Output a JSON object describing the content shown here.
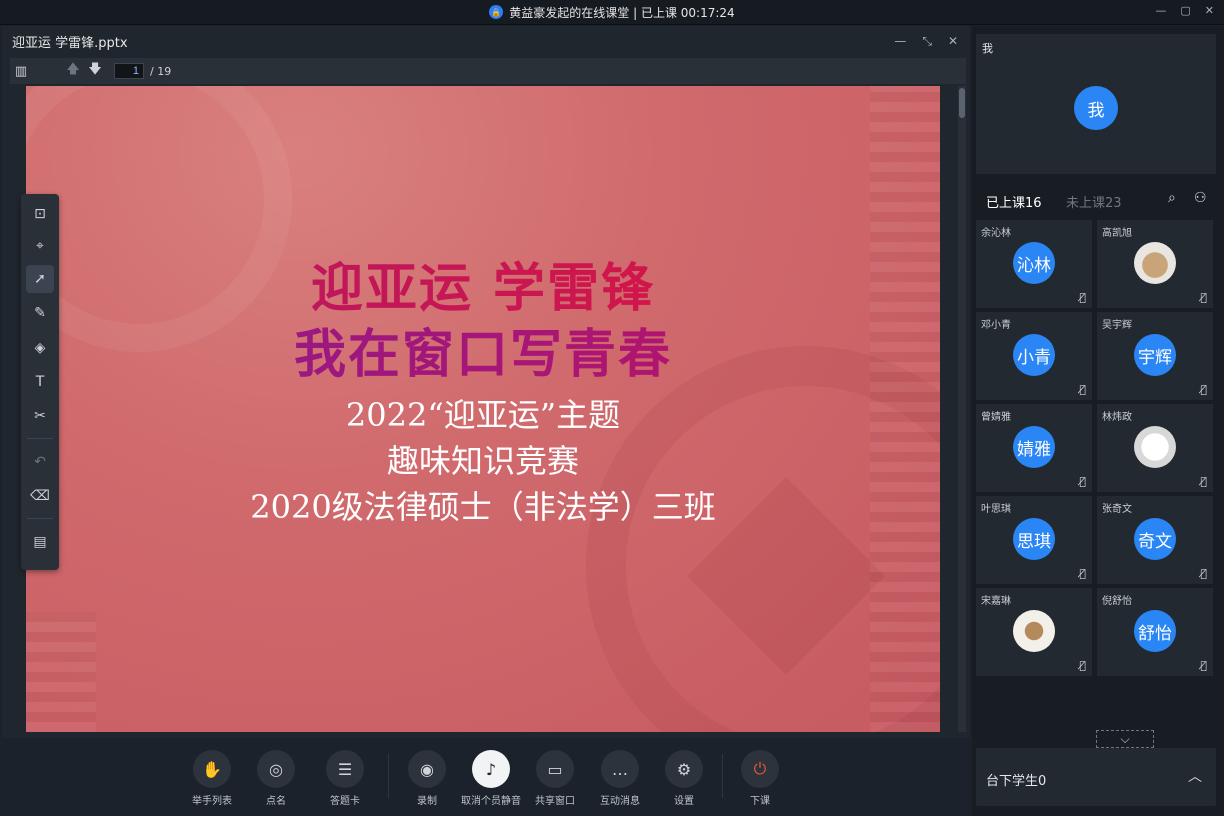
{
  "window": {
    "title": "黄益豪发起的在线课堂 | 已上课 00:17:24",
    "controls": [
      "—",
      "▢",
      "✕"
    ]
  },
  "document": {
    "filename": "迎亚运 学雷锋.pptx",
    "header_controls": [
      "—",
      "⤡",
      "✕"
    ],
    "page_current": "1",
    "page_total": "/ 19",
    "slide": {
      "line1": "迎亚运  学雷锋",
      "line2": "我在窗口写青春",
      "line3": "2022“迎亚运”主题",
      "line4": "趣味知识竞赛",
      "line5": "2020级法律硕士（非法学）三班"
    }
  },
  "toolbar_icons": [
    "sidebar-toggle-icon",
    "arrow-up-icon",
    "arrow-down-icon"
  ],
  "draw_tools": [
    "add-page-icon",
    "laser-pointer-icon",
    "select-pointer-icon",
    "pen-icon",
    "shapes-icon",
    "text-icon",
    "scissors-icon",
    "undo-icon",
    "eraser-icon",
    "toolbox-icon"
  ],
  "bottom_buttons": [
    {
      "label": "举手列表",
      "icon": "✋"
    },
    {
      "label": "点名",
      "icon": "◎"
    },
    {
      "label": "答题卡",
      "icon": "☰"
    },
    {
      "label": "录制",
      "icon": "◉"
    },
    {
      "label": "取消个员静音",
      "icon": "♪"
    },
    {
      "label": "共享窗口",
      "icon": "▭"
    },
    {
      "label": "互动消息",
      "icon": "…"
    },
    {
      "label": "设置",
      "icon": "⚙"
    },
    {
      "label": "下课",
      "icon": "⏻"
    }
  ],
  "me": {
    "label": "我",
    "avatar": "我"
  },
  "tabs": {
    "in_class": "已上课16",
    "not_in_class": "未上课23"
  },
  "students": [
    {
      "name": "余沁林",
      "avatar": "沁林",
      "photo": ""
    },
    {
      "name": "高凯旭",
      "avatar": "",
      "photo": "dog"
    },
    {
      "name": "邓小青",
      "avatar": "小青",
      "photo": ""
    },
    {
      "name": "吴宇辉",
      "avatar": "宇辉",
      "photo": ""
    },
    {
      "name": "曾婧雅",
      "avatar": "婧雅",
      "photo": ""
    },
    {
      "name": "林炜政",
      "avatar": "",
      "photo": "sketch"
    },
    {
      "name": "叶思琪",
      "avatar": "思琪",
      "photo": ""
    },
    {
      "name": "张奇文",
      "avatar": "奇文",
      "photo": ""
    },
    {
      "name": "宋嘉琳",
      "avatar": "",
      "photo": "food"
    },
    {
      "name": "倪舒怡",
      "avatar": "舒怡",
      "photo": ""
    }
  ],
  "offline": {
    "label": "台下学生0"
  },
  "colors": {
    "accent": "#2b86f5",
    "panel": "#222931",
    "background": "#1c222b",
    "slide": "#d06a6d",
    "leave": "#e0573a"
  }
}
